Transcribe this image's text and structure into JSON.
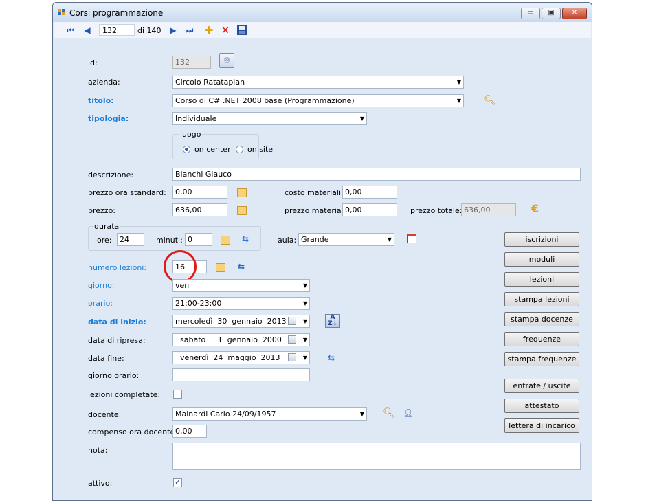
{
  "window": {
    "title": "Corsi programmazione",
    "minimize_label": "▭",
    "maximize_label": "▣",
    "close_label": "✕"
  },
  "toolbar": {
    "current_record": "132",
    "of_text": "di 140"
  },
  "icons": {
    "first": "first-record-icon",
    "prev": "previous-record-icon",
    "next": "next-record-icon",
    "last": "last-record-icon",
    "add": "add-icon",
    "delete": "delete-icon",
    "save": "save-icon",
    "binoculars": "binoculars-icon",
    "search": "search-icon",
    "edit": "edit-icon",
    "refresh": "refresh-icon",
    "euro": "euro-icon",
    "calendar": "calendar-icon",
    "sort": "sort-az-icon",
    "user": "user-icon"
  },
  "form": {
    "id": {
      "label": "id:",
      "value": "132"
    },
    "azienda": {
      "label": "azienda:",
      "value": "Circolo Ratataplan"
    },
    "titolo": {
      "label": "titolo:",
      "value": "Corso di C# .NET 2008 base (Programmazione)"
    },
    "tipologia": {
      "label": "tipologia:",
      "value": "Individuale"
    },
    "luogo": {
      "label": "luogo",
      "option_center": "on center",
      "option_site": "on site",
      "selected": "on center"
    },
    "descrizione": {
      "label": "descrizione:",
      "value": "Bianchi Glauco"
    },
    "prezzo_ora_standard": {
      "label": "prezzo ora standard:",
      "value": "0,00"
    },
    "costo_materiali": {
      "label": "costo materiali:",
      "value": "0,00"
    },
    "prezzo": {
      "label": "prezzo:",
      "value": "636,00"
    },
    "prezzo_materiali": {
      "label": "prezzo materiali:",
      "value": "0,00"
    },
    "prezzo_totale": {
      "label": "prezzo totale:",
      "value": "636,00"
    },
    "durata": {
      "label": "durata",
      "ore_label": "ore:",
      "ore_value": "24",
      "minuti_label": "minuti:",
      "minuti_value": "0"
    },
    "aula": {
      "label": "aula:",
      "value": "Grande"
    },
    "numero_lezioni": {
      "label": "numero lezioni:",
      "value": "16"
    },
    "giorno": {
      "label": "giorno:",
      "value": "ven"
    },
    "orario": {
      "label": "orario:",
      "value": "21:00-23:00"
    },
    "data_inizio": {
      "label": "data di inizio:",
      "value": "mercoledì  30  gennaio  2013"
    },
    "data_ripresa": {
      "label": "data di ripresa:",
      "value": "  sabato     1  gennaio  2000"
    },
    "data_fine": {
      "label": "data fine:",
      "value": "  venerdì  24  maggio  2013"
    },
    "giorno_orario": {
      "label": "giorno orario:",
      "value": ""
    },
    "lezioni_completate": {
      "label": "lezioni completate:",
      "checked": false
    },
    "docente": {
      "label": "docente:",
      "value": "Mainardi Carlo 24/09/1957"
    },
    "compenso_ora_docente": {
      "label": "compenso ora docente:",
      "value": "0,00"
    },
    "nota": {
      "label": "nota:",
      "value": ""
    },
    "attivo": {
      "label": "attivo:",
      "checked": true,
      "check_mark": "✓"
    }
  },
  "buttons": {
    "iscrizioni": "iscrizioni",
    "moduli": "moduli",
    "lezioni": "lezioni",
    "stampa_lezioni": "stampa lezioni",
    "stampa_docenze": "stampa docenze",
    "frequenze": "frequenze",
    "stampa_frequenze": "stampa frequenze",
    "entrate_uscite": "entrate / uscite",
    "attestato": "attestato",
    "lettera_incarico": "lettera di incarico"
  }
}
